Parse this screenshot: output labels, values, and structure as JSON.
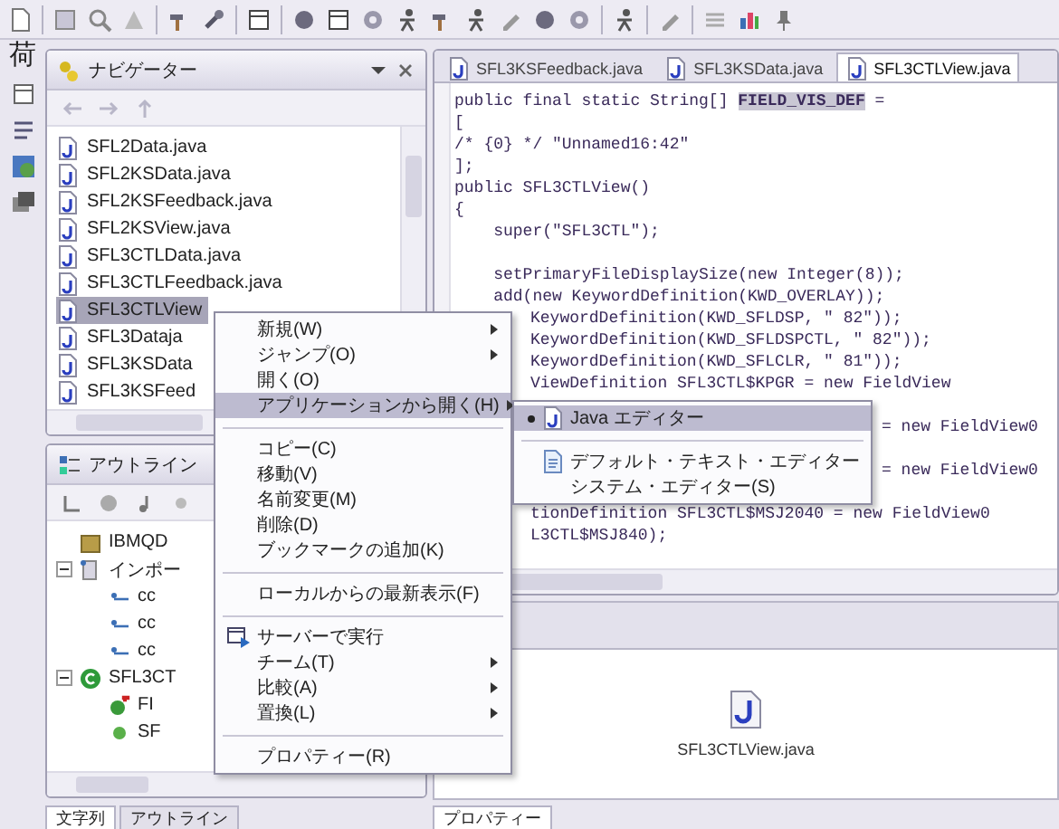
{
  "side_label": "荷",
  "navigator": {
    "title": "ナビゲーター",
    "files": [
      {
        "name": "SFL2Data.java",
        "selected": false
      },
      {
        "name": "SFL2KSData.java",
        "selected": false
      },
      {
        "name": "SFL2KSFeedback.java",
        "selected": false
      },
      {
        "name": "SFL2KSView.java",
        "selected": false
      },
      {
        "name": "SFL3CTLData.java",
        "selected": false
      },
      {
        "name": "SFL3CTLFeedback.java",
        "selected": false
      },
      {
        "name": "SFL3CTLView",
        "selected": true
      },
      {
        "name": "SFL3Dataja",
        "selected": false
      },
      {
        "name": "SFL3KSData",
        "selected": false
      },
      {
        "name": "SFL3KSFeed",
        "selected": false
      }
    ]
  },
  "outline": {
    "title": "アウトライン",
    "tree": [
      {
        "kind": "package",
        "label": "IBMQD"
      },
      {
        "kind": "imports",
        "label": "インポー",
        "expanded": true,
        "children": [
          {
            "kind": "import",
            "label": "cc"
          },
          {
            "kind": "import",
            "label": "cc"
          },
          {
            "kind": "import",
            "label": "cc"
          }
        ]
      },
      {
        "kind": "class",
        "label": "SFL3CT",
        "expanded": true,
        "children": [
          {
            "kind": "field",
            "label": "FI"
          },
          {
            "kind": "method",
            "label": "SF"
          }
        ]
      }
    ]
  },
  "bottom_tabs_left": [
    {
      "label": "文字列",
      "selected": true
    },
    {
      "label": "アウトライン",
      "selected": false
    }
  ],
  "editor": {
    "tabs": [
      {
        "label": "SFL3KSFeedback.java",
        "selected": false
      },
      {
        "label": "SFL3KSData.java",
        "selected": false
      },
      {
        "label": "SFL3CTLView.java",
        "selected": true
      }
    ],
    "lines": [
      {
        "kind": "code",
        "text": "public final static String[] **FIELD_VIS_DEF** ="
      },
      {
        "kind": "code",
        "text": "["
      },
      {
        "kind": "code",
        "text": "/* {0} */ \"Unnamed16:42\""
      },
      {
        "kind": "code",
        "text": "];"
      },
      {
        "kind": "code",
        "text": "public SFL3CTLView()"
      },
      {
        "kind": "code",
        "text": "{"
      },
      {
        "kind": "code",
        "text": "    super(\"SFL3CTL\");"
      },
      {
        "kind": "blank"
      },
      {
        "kind": "code",
        "text": "    setPrimaryFileDisplaySize(new Integer(8));"
      },
      {
        "kind": "code",
        "text": "    add(new KeywordDefinition(KWD_OVERLAY));"
      },
      {
        "kind": "after_menu",
        "text": "KeywordDefinition(KWD_SFLDSP, \" 82\"));"
      },
      {
        "kind": "after_menu",
        "text": "KeywordDefinition(KWD_SFLDSPCTL, \" 82\"));"
      },
      {
        "kind": "after_menu",
        "text": "KeywordDefinition(KWD_SFLCLR, \" 81\"));"
      },
      {
        "kind": "after_menu",
        "text": "ViewDefinition SFL3CTL$KPGR = new FieldView"
      },
      {
        "kind": "blank"
      },
      {
        "kind": "after_submenu",
        "text": "= new FieldView0"
      },
      {
        "kind": "blank"
      },
      {
        "kind": "after_submenu",
        "text": "= new FieldView0"
      },
      {
        "kind": "blank"
      },
      {
        "kind": "after_menu",
        "text": "tionDefinition SFL3CTL$MSJ2040 = new FieldView0"
      },
      {
        "kind": "after_menu",
        "text": "L3CTL$MSJ840);"
      }
    ]
  },
  "preview": {
    "file_name": "SFL3CTLView.java"
  },
  "bottom_tabs_right": [
    {
      "label": "プロパティー",
      "selected": true
    }
  ],
  "context_menu": {
    "items": [
      {
        "kind": "item",
        "label": "新規(W)",
        "submenu": true,
        "selected": false
      },
      {
        "kind": "item",
        "label": "ジャンプ(O)",
        "submenu": true,
        "selected": false
      },
      {
        "kind": "item",
        "label": "開く(O)",
        "submenu": false,
        "selected": false
      },
      {
        "kind": "item",
        "label": "アプリケーションから開く(H)",
        "submenu": true,
        "selected": true
      },
      {
        "kind": "separator"
      },
      {
        "kind": "item",
        "label": "コピー(C)",
        "submenu": false,
        "selected": false
      },
      {
        "kind": "item",
        "label": "移動(V)",
        "submenu": false,
        "selected": false
      },
      {
        "kind": "item",
        "label": "名前変更(M)",
        "submenu": false,
        "selected": false
      },
      {
        "kind": "item",
        "label": "削除(D)",
        "submenu": false,
        "selected": false
      },
      {
        "kind": "item",
        "label": "ブックマークの追加(K)",
        "submenu": false,
        "selected": false
      },
      {
        "kind": "separator"
      },
      {
        "kind": "item",
        "label": "ローカルからの最新表示(F)",
        "submenu": false,
        "selected": false
      },
      {
        "kind": "separator"
      },
      {
        "kind": "icon_item",
        "label": "サーバーで実行",
        "submenu": false,
        "selected": false
      },
      {
        "kind": "item",
        "label": "チーム(T)",
        "submenu": true,
        "selected": false
      },
      {
        "kind": "item",
        "label": "比較(A)",
        "submenu": true,
        "selected": false
      },
      {
        "kind": "item",
        "label": "置換(L)",
        "submenu": true,
        "selected": false
      },
      {
        "kind": "separator"
      },
      {
        "kind": "item",
        "label": "プロパティー(R)",
        "submenu": false,
        "selected": false
      }
    ]
  },
  "submenu": {
    "items": [
      {
        "kind": "java_item",
        "label": "Java エディター",
        "checked": true,
        "selected": true
      },
      {
        "kind": "separator"
      },
      {
        "kind": "text_item",
        "label": "デフォルト・テキスト・エディター",
        "checked": false,
        "selected": false
      },
      {
        "kind": "item",
        "label": "システム・エディター(S)",
        "checked": false,
        "selected": false
      }
    ]
  }
}
